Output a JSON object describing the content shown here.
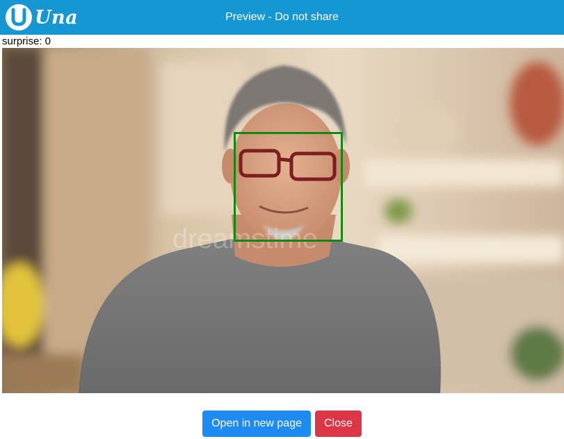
{
  "header": {
    "logo_text": "Una",
    "title": "Preview - Do not share",
    "color": "#1597d4"
  },
  "status": {
    "text": "surprise: 0"
  },
  "preview": {
    "watermark": "dreamstime",
    "face_box_color": "#0f8a0f"
  },
  "actions": {
    "open_label": "Open in new page",
    "close_label": "Close",
    "open_color": "#1d8bf2",
    "close_color": "#dc3545"
  }
}
